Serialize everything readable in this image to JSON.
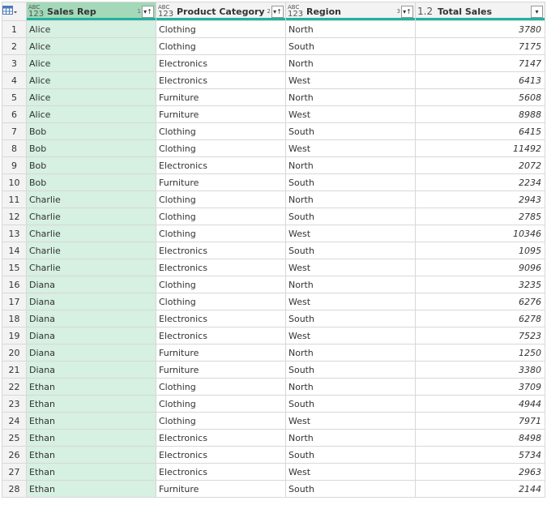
{
  "grid": {
    "corner_icon": "table-icon",
    "columns": [
      {
        "name": "Sales Rep",
        "type_icon": "ABC 123",
        "sort_index": "1",
        "sort": "ascending",
        "selected": true
      },
      {
        "name": "Product Category",
        "type_icon": "ABC 123",
        "sort_index": "2",
        "sort": "ascending",
        "selected": false
      },
      {
        "name": "Region",
        "type_icon": "ABC 123",
        "sort_index": "3",
        "sort": "ascending",
        "selected": false
      },
      {
        "name": "Total Sales",
        "type_icon": "1.2",
        "sort_index": "",
        "sort": "none",
        "selected": false
      }
    ],
    "rows": [
      {
        "n": "1",
        "rep": "Alice",
        "cat": "Clothing",
        "region": "North",
        "sales": "3780"
      },
      {
        "n": "2",
        "rep": "Alice",
        "cat": "Clothing",
        "region": "South",
        "sales": "7175"
      },
      {
        "n": "3",
        "rep": "Alice",
        "cat": "Electronics",
        "region": "North",
        "sales": "7147"
      },
      {
        "n": "4",
        "rep": "Alice",
        "cat": "Electronics",
        "region": "West",
        "sales": "6413"
      },
      {
        "n": "5",
        "rep": "Alice",
        "cat": "Furniture",
        "region": "North",
        "sales": "5608"
      },
      {
        "n": "6",
        "rep": "Alice",
        "cat": "Furniture",
        "region": "West",
        "sales": "8988"
      },
      {
        "n": "7",
        "rep": "Bob",
        "cat": "Clothing",
        "region": "South",
        "sales": "6415"
      },
      {
        "n": "8",
        "rep": "Bob",
        "cat": "Clothing",
        "region": "West",
        "sales": "11492"
      },
      {
        "n": "9",
        "rep": "Bob",
        "cat": "Electronics",
        "region": "North",
        "sales": "2072"
      },
      {
        "n": "10",
        "rep": "Bob",
        "cat": "Furniture",
        "region": "South",
        "sales": "2234"
      },
      {
        "n": "11",
        "rep": "Charlie",
        "cat": "Clothing",
        "region": "North",
        "sales": "2943"
      },
      {
        "n": "12",
        "rep": "Charlie",
        "cat": "Clothing",
        "region": "South",
        "sales": "2785"
      },
      {
        "n": "13",
        "rep": "Charlie",
        "cat": "Clothing",
        "region": "West",
        "sales": "10346"
      },
      {
        "n": "14",
        "rep": "Charlie",
        "cat": "Electronics",
        "region": "South",
        "sales": "1095"
      },
      {
        "n": "15",
        "rep": "Charlie",
        "cat": "Electronics",
        "region": "West",
        "sales": "9096"
      },
      {
        "n": "16",
        "rep": "Diana",
        "cat": "Clothing",
        "region": "North",
        "sales": "3235"
      },
      {
        "n": "17",
        "rep": "Diana",
        "cat": "Clothing",
        "region": "West",
        "sales": "6276"
      },
      {
        "n": "18",
        "rep": "Diana",
        "cat": "Electronics",
        "region": "South",
        "sales": "6278"
      },
      {
        "n": "19",
        "rep": "Diana",
        "cat": "Electronics",
        "region": "West",
        "sales": "7523"
      },
      {
        "n": "20",
        "rep": "Diana",
        "cat": "Furniture",
        "region": "North",
        "sales": "1250"
      },
      {
        "n": "21",
        "rep": "Diana",
        "cat": "Furniture",
        "region": "South",
        "sales": "3380"
      },
      {
        "n": "22",
        "rep": "Ethan",
        "cat": "Clothing",
        "region": "North",
        "sales": "3709"
      },
      {
        "n": "23",
        "rep": "Ethan",
        "cat": "Clothing",
        "region": "South",
        "sales": "4944"
      },
      {
        "n": "24",
        "rep": "Ethan",
        "cat": "Clothing",
        "region": "West",
        "sales": "7971"
      },
      {
        "n": "25",
        "rep": "Ethan",
        "cat": "Electronics",
        "region": "North",
        "sales": "8498"
      },
      {
        "n": "26",
        "rep": "Ethan",
        "cat": "Electronics",
        "region": "South",
        "sales": "5734"
      },
      {
        "n": "27",
        "rep": "Ethan",
        "cat": "Electronics",
        "region": "West",
        "sales": "2963"
      },
      {
        "n": "28",
        "rep": "Ethan",
        "cat": "Furniture",
        "region": "South",
        "sales": "2144"
      }
    ]
  },
  "colors": {
    "selected_header": "#a3d9b8",
    "selected_column": "#d6f0e1",
    "quality_bar": "#1eb39f"
  }
}
